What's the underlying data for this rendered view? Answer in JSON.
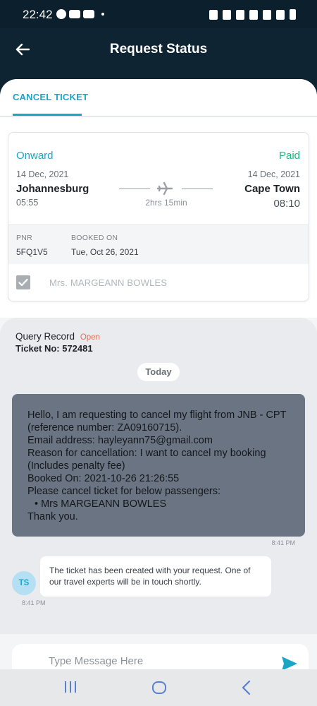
{
  "status_bar": {
    "time": "22:42",
    "left_icons": [
      "whatsapp-icon",
      "youtube-icon",
      "youtube-icon"
    ],
    "right_icons": [
      "lock-icon",
      "alarm-icon",
      "mute-icon",
      "location-icon",
      "wifi-icon",
      "signal-icon",
      "battery-icon"
    ]
  },
  "header": {
    "title": "Request Status"
  },
  "tabs": {
    "active": "CANCEL TICKET"
  },
  "ticket": {
    "direction": "Onward",
    "status": "Paid",
    "from": {
      "date": "14 Dec, 2021",
      "city": "Johannesburg",
      "time": "05:55"
    },
    "to": {
      "date": "14 Dec, 2021",
      "city": "Cape Town",
      "time": "08:10"
    },
    "duration": "2hrs  15min",
    "pnr_label": "PNR",
    "pnr": "5FQ1V5",
    "booked_on_label": "BOOKED ON",
    "booked_on": "Tue, Oct 26, 2021",
    "passenger": "Mrs. MARGEANN  BOWLES"
  },
  "query": {
    "title": "Query Record",
    "status": "Open",
    "ticket_no": "Ticket No: 572481"
  },
  "chat": {
    "day_divider": "Today",
    "user_message": {
      "lines": [
        "Hello, I am requesting to cancel my flight from JNB - CPT",
        "(reference number: ZA09160715).",
        "Email address: hayleyann75@gmail.com",
        "Reason for cancellation: I want to cancel my booking",
        "(Includes penalty fee)",
        "Booked On: 2021-10-26 21:26:55",
        "Please cancel ticket for below passengers:",
        "• Mrs MARGEANN BOWLES",
        "Thank you."
      ],
      "time": "8:41 PM"
    },
    "agent_message": {
      "avatar": "TS",
      "text": "The ticket has been created with your request. One of our travel experts will be in touch shortly.",
      "time": "8:41 PM"
    }
  },
  "composer": {
    "placeholder": "Type Message Here"
  },
  "colors": {
    "accent": "#1ca6c6",
    "paid": "#1db87d",
    "open": "#e86c5a",
    "header_bg": "#0e2433"
  }
}
